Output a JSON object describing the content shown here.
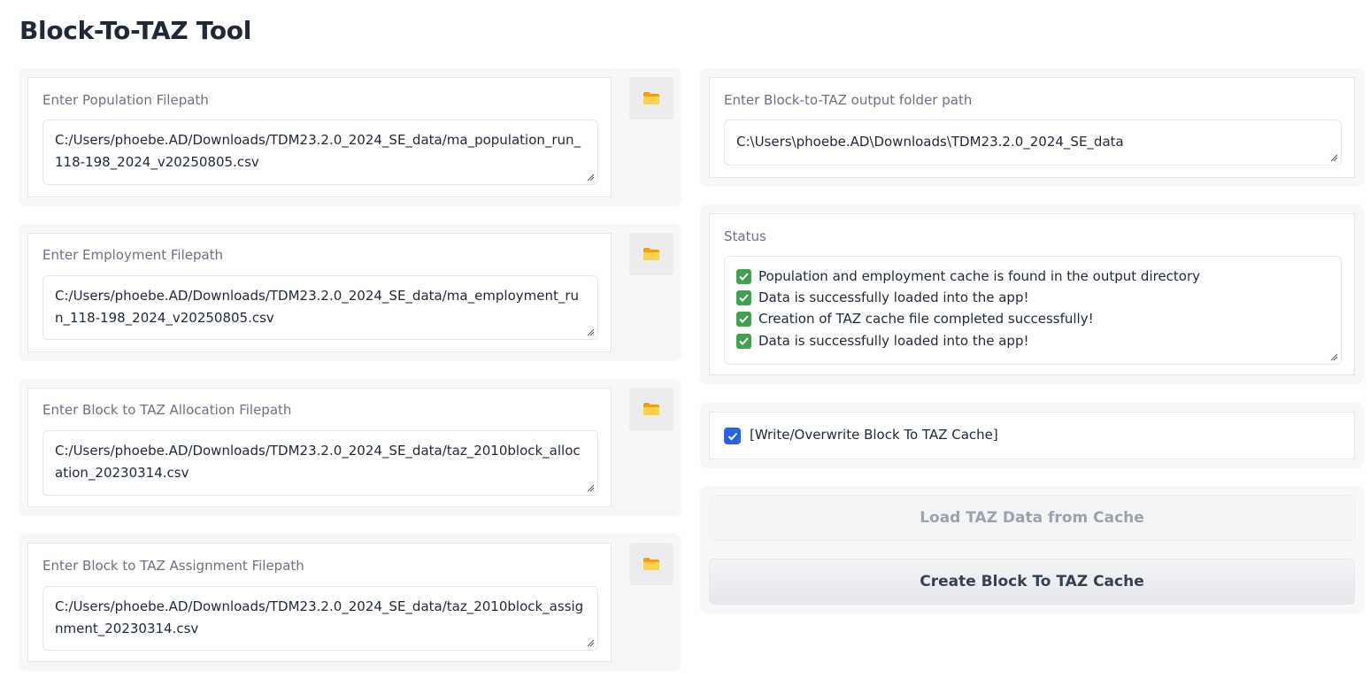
{
  "app": {
    "title": "Block-To-TAZ Tool"
  },
  "inputs": [
    {
      "label": "Enter Population Filepath",
      "value": "C:/Users/phoebe.AD/Downloads/TDM23.2.0_2024_SE_data/ma_population_run_118-198_2024_v20250805.csv"
    },
    {
      "label": "Enter Employment Filepath",
      "value": "C:/Users/phoebe.AD/Downloads/TDM23.2.0_2024_SE_data/ma_employment_run_118-198_2024_v20250805.csv"
    },
    {
      "label": "Enter Block to TAZ Allocation Filepath",
      "value": "C:/Users/phoebe.AD/Downloads/TDM23.2.0_2024_SE_data/taz_2010block_allocation_20230314.csv"
    },
    {
      "label": "Enter Block to TAZ Assignment Filepath",
      "value": "C:/Users/phoebe.AD/Downloads/TDM23.2.0_2024_SE_data/taz_2010block_assignment_20230314.csv"
    }
  ],
  "output": {
    "label": "Enter Block-to-TAZ output folder path",
    "value": "C:\\Users\\phoebe.AD\\Downloads\\TDM23.2.0_2024_SE_data"
  },
  "status": {
    "label": "Status",
    "lines": [
      "Population and employment cache is found in the output directory",
      "Data is successfully loaded into the app!",
      "Creation of TAZ cache file completed successfully!",
      "Data is successfully loaded into the app!"
    ]
  },
  "overwrite": {
    "label": "[Write/Overwrite Block To TAZ Cache]",
    "checked": true
  },
  "buttons": {
    "load": "Load TAZ Data from Cache",
    "create": "Create Block To TAZ Cache"
  },
  "colors": {
    "accent": "#2563eb",
    "folder": "#fbbf24",
    "check": "#3fa34d"
  },
  "icons": {
    "browse": "folder-icon",
    "status": "check-mark-emoji",
    "checkbox": "check-icon"
  }
}
